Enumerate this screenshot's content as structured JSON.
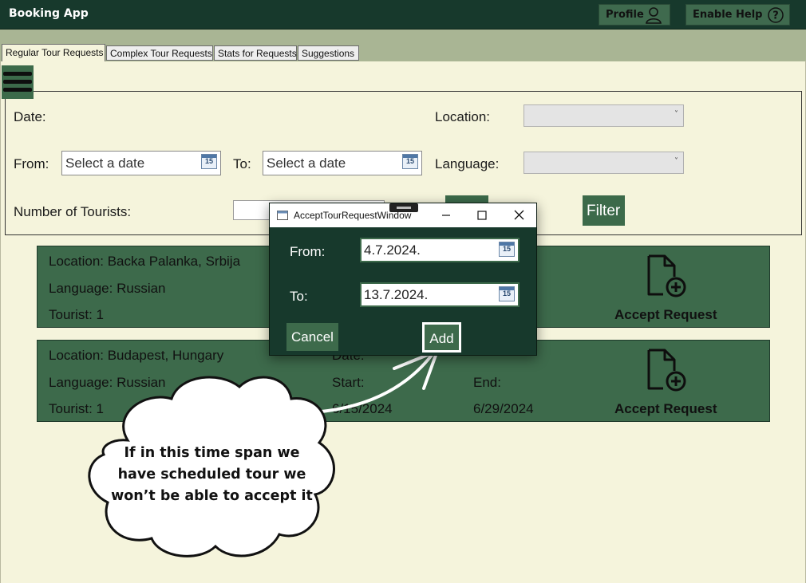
{
  "app": {
    "title": "Booking App",
    "profile_label": "Profile",
    "help_label": "Enable Help"
  },
  "tabs": [
    {
      "label": "Regular Tour Requests",
      "active": true
    },
    {
      "label": "Complex Tour Requests",
      "active": false
    },
    {
      "label": "Stats for Requests",
      "active": false
    },
    {
      "label": "Suggestions",
      "active": false
    }
  ],
  "filters": {
    "date_label": "Date:",
    "location_label": "Location:",
    "from_label": "From:",
    "from_placeholder": "Select a date",
    "to_label": "To:",
    "to_placeholder": "Select a date",
    "language_label": "Language:",
    "tourists_label": "Number of Tourists:",
    "filter_button": "Filter",
    "calendar_day": "15"
  },
  "requests": [
    {
      "location": "Location: Backa Palanka, Srbija",
      "language": "Language: Russian",
      "tourist": "Tourist: 1",
      "accept_label": "Accept Request"
    },
    {
      "location": "Location: Budapest, Hungary",
      "language": "Language: Russian",
      "tourist": "Tourist: 1",
      "date_label": "Date:",
      "start_label": "Start:",
      "end_label": "End:",
      "start_value": "6/15/2024",
      "end_value": "6/29/2024",
      "accept_label": "Accept Request"
    }
  ],
  "dialog": {
    "title": "AcceptTourRequestWindow",
    "from_label": "From:",
    "from_value": "4.7.2024.",
    "to_label": "To:",
    "to_value": "13.7.2024.",
    "cancel_label": "Cancel",
    "add_label": "Add"
  },
  "annotation": {
    "line1": "If in this time span we",
    "line2": "have scheduled tour we",
    "line3": "won’t be able to accept it"
  },
  "colors": {
    "titlebar": "#17392c",
    "accent_green": "#3d6a4b",
    "background": "#f5f4dc",
    "tab_band": "#a9b594"
  }
}
